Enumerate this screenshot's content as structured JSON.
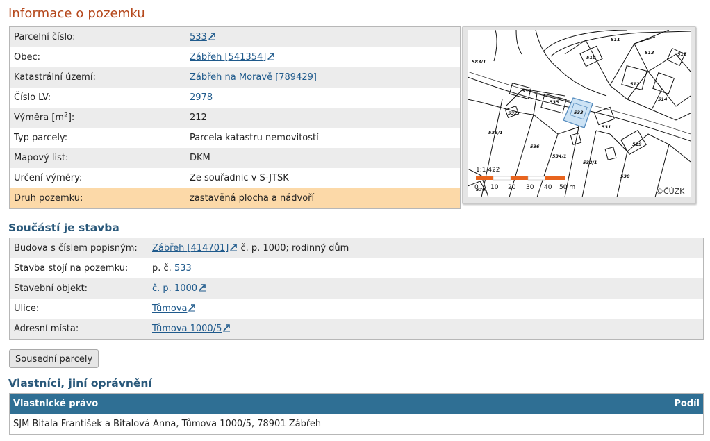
{
  "title": "Informace o pozemku",
  "parcel": {
    "rows": [
      {
        "label": "Parcelní číslo:",
        "value": "533",
        "link": true,
        "ext": true
      },
      {
        "label": "Obec:",
        "value": "Zábřeh [541354]",
        "link": true,
        "ext": true
      },
      {
        "label": "Katastrální území:",
        "value": "Zábřeh na Moravě [789429]",
        "link": true,
        "ext": false
      },
      {
        "label": "Číslo LV:",
        "value": "2978",
        "link": true,
        "ext": false
      },
      {
        "label_pre": "Výměra [m",
        "label_sup": "2",
        "label_post": "]:",
        "value": "212"
      },
      {
        "label": "Typ parcely:",
        "value": "Parcela katastru nemovitostí"
      },
      {
        "label": "Mapový list:",
        "value": "DKM"
      },
      {
        "label": "Určení výměry:",
        "value": "Ze souřadnic v S-JTSK"
      },
      {
        "label": "Druh pozemku:",
        "value": "zastavěná plocha a nádvoří"
      }
    ]
  },
  "map": {
    "scale_ratio": "1:1 422",
    "scale_ticks": [
      "0",
      "10",
      "20",
      "30",
      "40",
      "50 m"
    ],
    "copyright": "©ČÚZK",
    "parcel_labels": [
      "511",
      "510",
      "513",
      "515",
      "583/1",
      "512",
      "514",
      "537",
      "535",
      "533",
      "5311",
      "532",
      "531",
      "536/1",
      "536",
      "534/1",
      "532/1",
      "529",
      "530",
      "576",
      "500",
      "5375",
      "520"
    ],
    "selected_parcel": "533",
    "colors": {
      "selected_fill": "#cde3f5",
      "selected_stroke": "#5a8fc0",
      "scalebar": "#e8641e"
    }
  },
  "building": {
    "heading": "Součástí je stavba",
    "rows": [
      {
        "label": "Budova s číslem popisným:",
        "link": "Zábřeh [414701]",
        "ext": true,
        "suffix": " č. p. 1000; rodinný dům"
      },
      {
        "label": "Stavba stojí na pozemku:",
        "prefix": "p. č. ",
        "link": "533",
        "ext": false
      },
      {
        "label": "Stavební objekt:",
        "link": "č. p. 1000",
        "ext": true
      },
      {
        "label": "Ulice:",
        "link": "Tůmova",
        "ext": true
      },
      {
        "label": "Adresní místa:",
        "link": "Tůmova 1000/5",
        "ext": true
      }
    ]
  },
  "neighbors_button": "Sousední parcely",
  "owners": {
    "heading": "Vlastníci, jiní oprávnění",
    "col_right": "Vlastnické právo",
    "col_share": "Podíl",
    "rows": [
      {
        "name": "SJM Bitala František a Bitalová Anna, Tůmova 1000/5, 78901 Zábřeh",
        "share": ""
      }
    ]
  },
  "colors": {
    "title": "#b5481c",
    "heading": "#29587a",
    "link": "#1f5a8c",
    "highlight_row": "#fcd9a8",
    "table_header": "#2f6f94"
  }
}
